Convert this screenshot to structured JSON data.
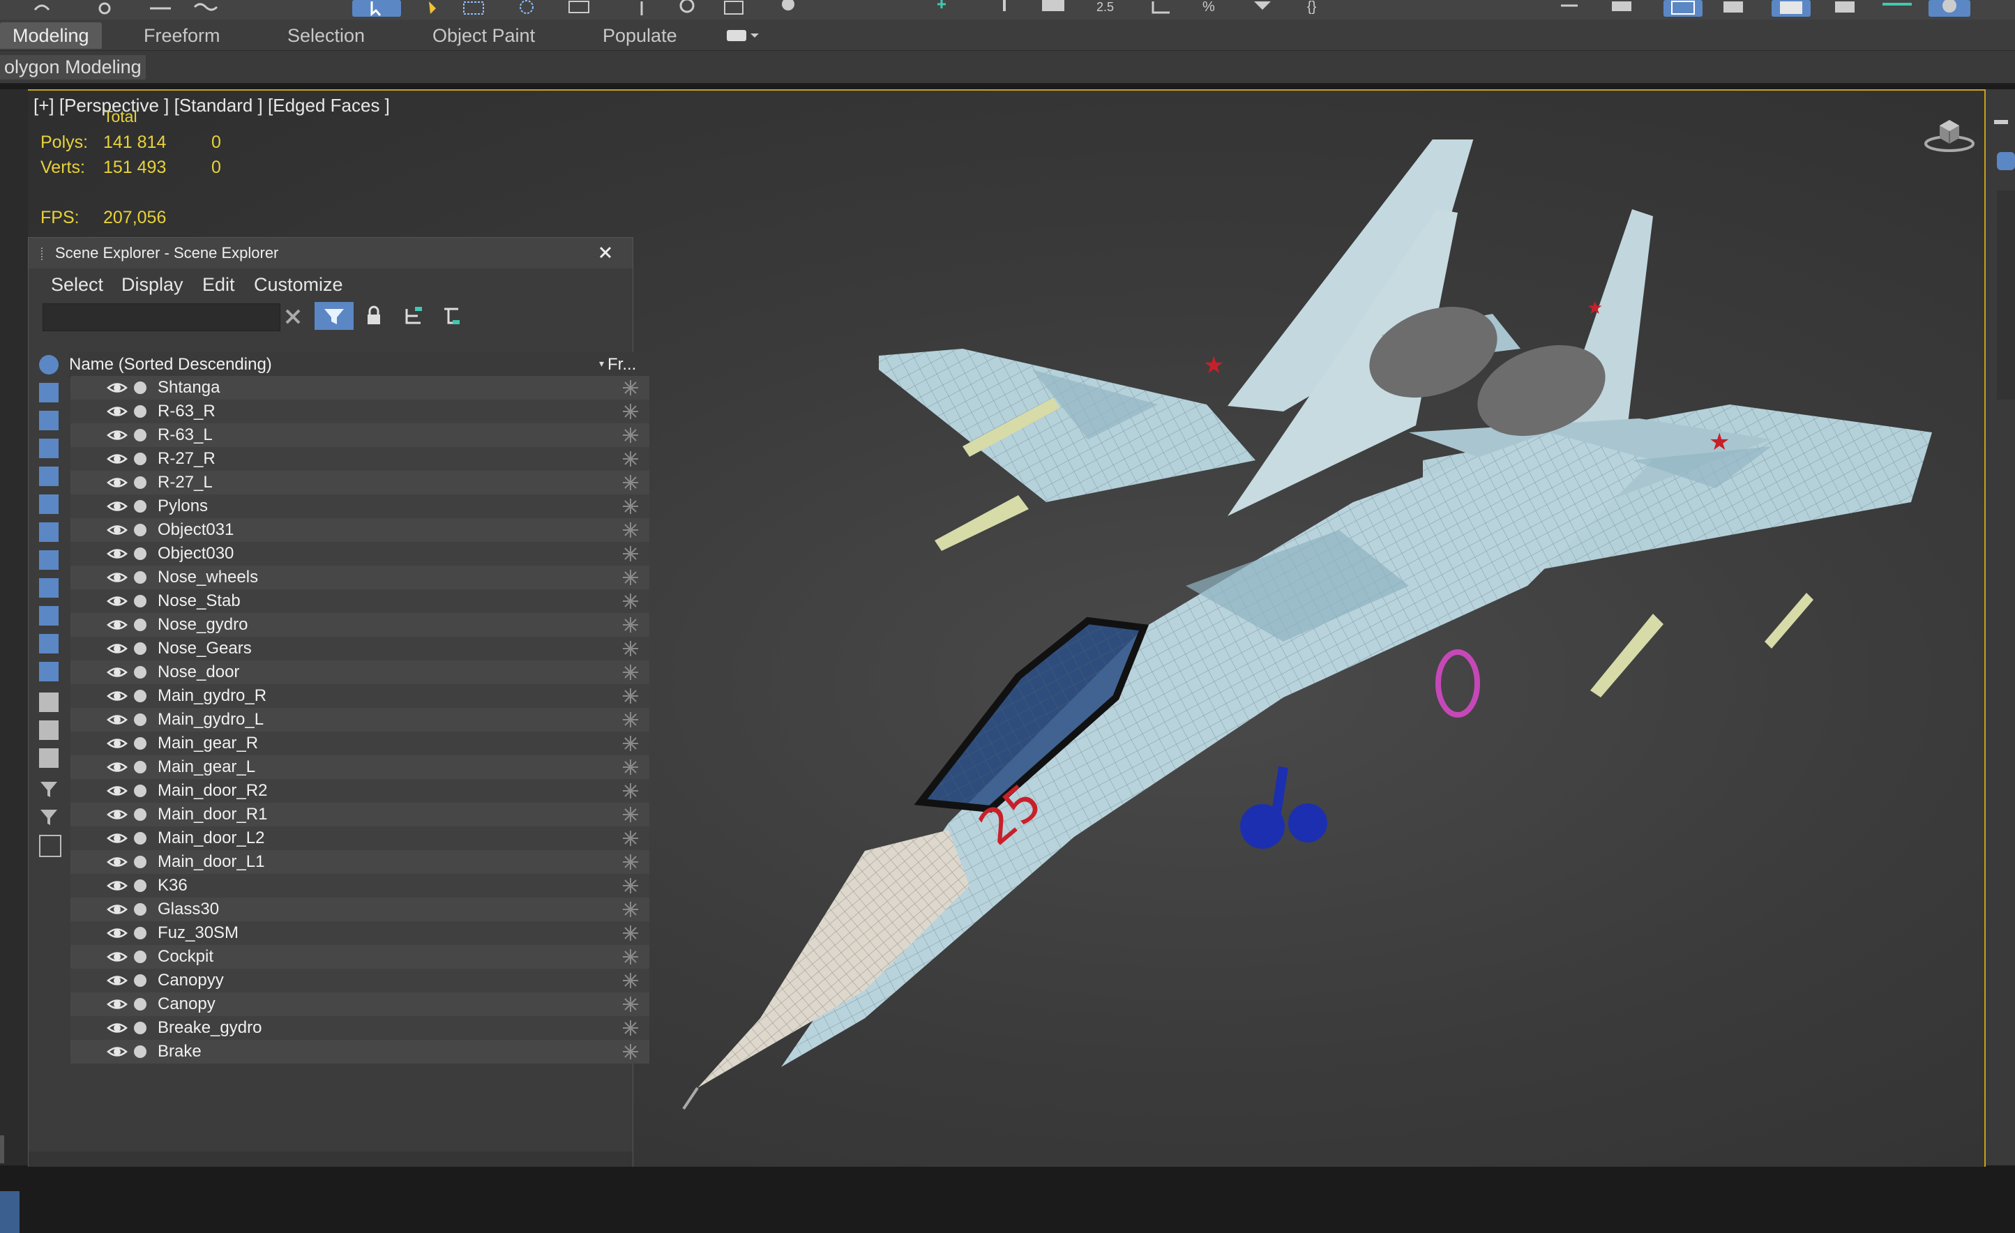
{
  "ribbon": {
    "tabs": [
      "Modeling",
      "Freeform",
      "Selection",
      "Object Paint",
      "Populate"
    ],
    "active_tab": "Modeling",
    "subpanel_label": "olygon Modeling"
  },
  "viewport": {
    "label": "[+] [Perspective ] [Standard ] [Edged Faces ]",
    "stats": {
      "total_label": "Total",
      "polys_label": "Polys:",
      "polys_total": "141 814",
      "polys_selected": "0",
      "verts_label": "Verts:",
      "verts_total": "151 493",
      "verts_selected": "0",
      "fps_label": "FPS:",
      "fps_value": "207,056"
    },
    "model_marking": "25"
  },
  "scene_explorer": {
    "title": "Scene Explorer - Scene Explorer",
    "menu": [
      "Select",
      "Display",
      "Edit",
      "Customize"
    ],
    "search_value": "",
    "column_name": "Name (Sorted Descending)",
    "column_freeze": "Fr...",
    "objects": [
      "Shtanga",
      "R-63_R",
      "R-63_L",
      "R-27_R",
      "R-27_L",
      "Pylons",
      "Object031",
      "Object030",
      "Nose_wheels",
      "Nose_Stab",
      "Nose_gydro",
      "Nose_Gears",
      "Nose_door",
      "Main_gydro_R",
      "Main_gydro_L",
      "Main_gear_R",
      "Main_gear_L",
      "Main_door_R2",
      "Main_door_R1",
      "Main_door_L2",
      "Main_door_L1",
      "K36",
      "Glass30",
      "Fuz_30SM",
      "Cockpit",
      "Canopyy",
      "Canopy",
      "Breake_gydro",
      "Brake"
    ]
  },
  "colors": {
    "accent": "#5b87c5",
    "viewport_border": "#c9a21a",
    "stats_text": "#e8d23a",
    "aircraft_body": "#b7d3dc",
    "star": "#c8202a"
  }
}
